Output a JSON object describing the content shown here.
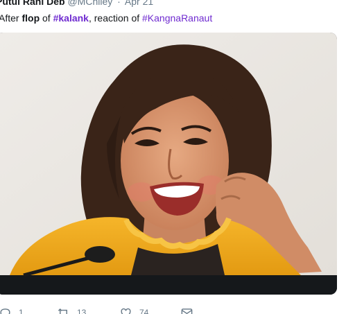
{
  "tweet": {
    "author_name": "Putul Rani Deb",
    "author_handle": "@MChiley",
    "separator": "·",
    "date": "Apr 21",
    "text": {
      "part1": "After ",
      "bold1": "flop",
      "part2": " of ",
      "hashtag1": "#kalank",
      "part3": ", reaction of ",
      "hashtag2": "#KangnaRanaut"
    }
  },
  "actions": {
    "reply_count": "1",
    "retweet_count": "13",
    "like_count": "74"
  },
  "colors": {
    "hashtag": "#6f2bd0",
    "meta_text": "#657786",
    "media_background": "#15181b"
  },
  "icons": [
    "reply-icon",
    "retweet-icon",
    "like-icon",
    "direct-message-icon"
  ]
}
